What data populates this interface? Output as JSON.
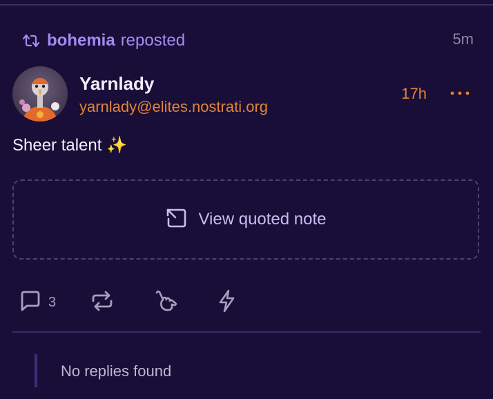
{
  "repost": {
    "icon": "repost-icon",
    "username": "bohemia",
    "label": "reposted",
    "time": "5m"
  },
  "note": {
    "author": {
      "name": "Yarnlady",
      "handle": "yarnlady@elites.nostrati.org",
      "avatar": "avatar-image"
    },
    "time": "17h",
    "content": "Sheer talent ✨",
    "more_icon": "more-horizontal-icon"
  },
  "quote": {
    "label": "View quoted note",
    "icon": "open-external-icon"
  },
  "actions": {
    "reply": {
      "icon": "comment-icon",
      "count": "3"
    },
    "repost": {
      "icon": "repost-icon"
    },
    "shaka": {
      "icon": "shaka-hand-icon"
    },
    "zap": {
      "icon": "lightning-icon"
    }
  },
  "replies": {
    "empty_label": "No replies found"
  },
  "colors": {
    "background": "#190e38",
    "accent_purple": "#a58af0",
    "accent_orange": "#e0843a",
    "muted": "#8c86a4"
  }
}
